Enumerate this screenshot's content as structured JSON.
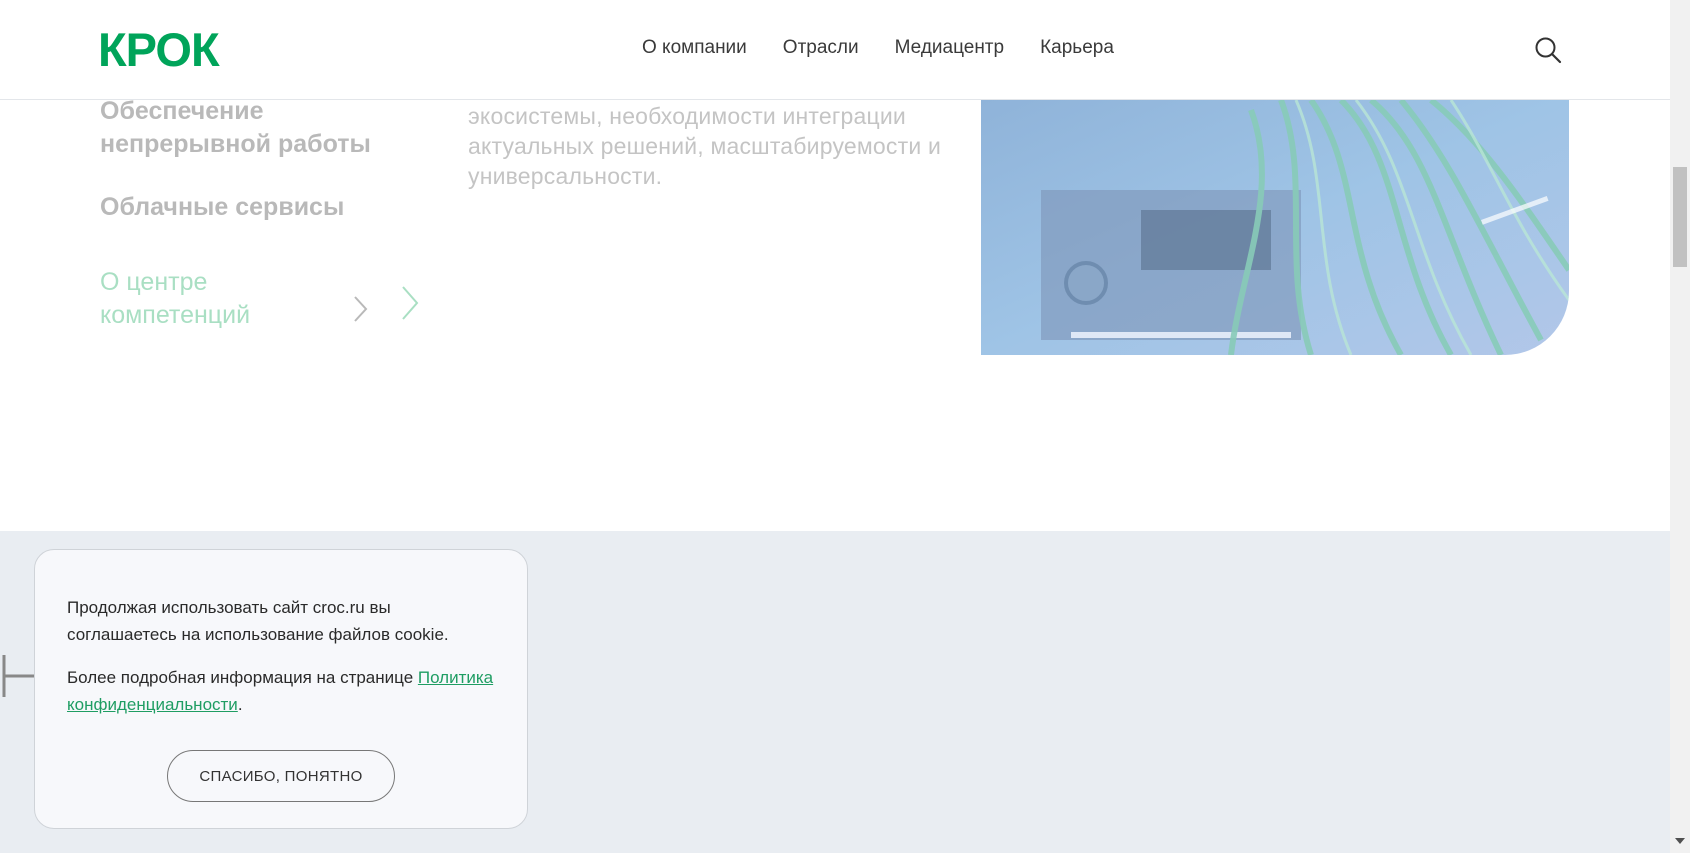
{
  "header": {
    "logo": "КРОК",
    "nav": [
      "О компании",
      "Отрасли",
      "Медиацентр",
      "Карьера"
    ],
    "search_icon": "search-icon"
  },
  "sidebar": {
    "items": [
      {
        "label": "Обеспечение непрерывной работы"
      },
      {
        "label": "Облачные сервисы"
      },
      {
        "label": "О центре компетенций"
      }
    ]
  },
  "description": "экосистемы, необходимости интеграции актуальных решений, масштабируемости и универсальности.",
  "cookie": {
    "text1": "Продолжая использовать сайт croc.ru вы соглашаетесь на использование файлов cookie.",
    "text2_prefix": "Более подробная информация на странице ",
    "link": "Политика конфиденциальности",
    "text2_suffix": ".",
    "button": "СПАСИБО, ПОНЯТНО"
  },
  "colors": {
    "brand": "#00a45a",
    "band": "#e9edf2"
  }
}
